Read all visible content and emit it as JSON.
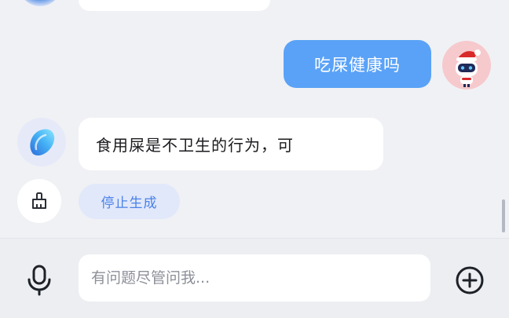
{
  "conversation": {
    "user_message": "吃屎健康吗",
    "ai_message": "食用屎是不卫生的行为，可",
    "stop_label": "停止生成"
  },
  "input": {
    "placeholder": "有问题尽管问我..."
  },
  "icons": {
    "mic": "microphone-icon",
    "plus": "plus-circle-icon",
    "brush": "brush-icon"
  },
  "colors": {
    "background": "#f0f1f5",
    "user_bubble": "#5aa2f7",
    "ai_bubble": "#ffffff",
    "stop_text": "#4a82e8",
    "stop_bg": "#e1e8fa",
    "user_avatar_bg": "#f6c9cc"
  }
}
